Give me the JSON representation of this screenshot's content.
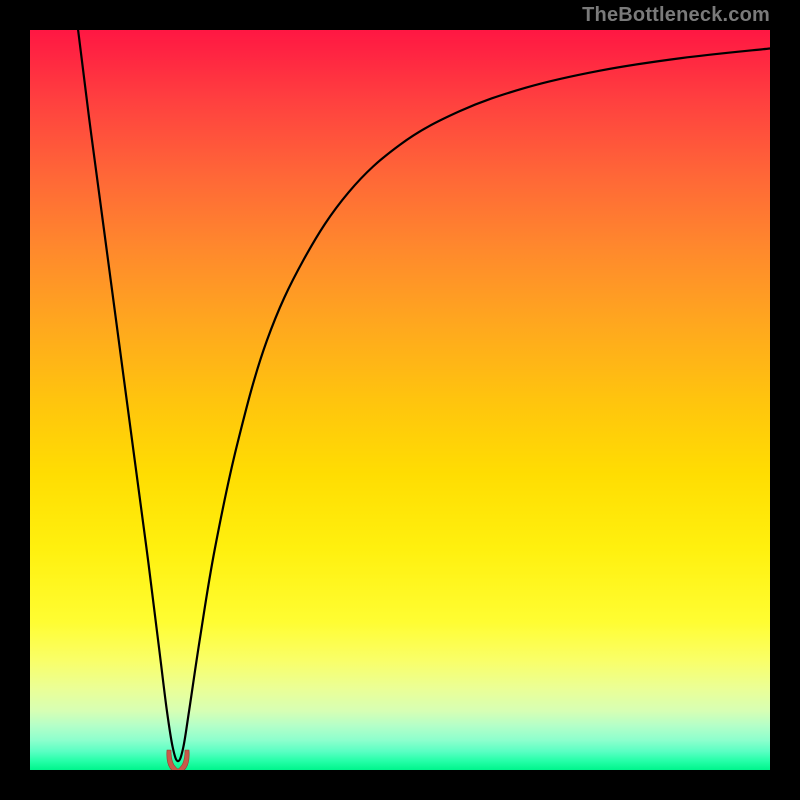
{
  "watermark": "TheBottleneck.com",
  "chart_data": {
    "type": "line",
    "title": "",
    "xlabel": "",
    "ylabel": "",
    "xlim": [
      0,
      100
    ],
    "ylim": [
      0,
      100
    ],
    "series": [
      {
        "name": "bottleneck-curve",
        "x": [
          6.5,
          8,
          10,
          12,
          14,
          16,
          17.5,
          18.5,
          19.3,
          20,
          20.7,
          21.5,
          23,
          25,
          28,
          32,
          37,
          43,
          50,
          58,
          67,
          77,
          88,
          100
        ],
        "y": [
          100,
          88,
          73,
          58,
          43,
          28,
          16,
          8,
          3,
          1.2,
          3,
          8,
          18,
          30,
          44,
          58,
          69,
          78,
          84.5,
          89,
          92.2,
          94.5,
          96.2,
          97.5
        ]
      }
    ],
    "marker": {
      "name": "optimal-point",
      "shape": "u-glyph",
      "color": "#c85a4a",
      "x": 20,
      "y": 1.2
    },
    "background": {
      "type": "vertical-gradient",
      "top_to_bottom_meaning": "high-bottleneck-to-low-bottleneck",
      "stops": [
        {
          "pct": 0,
          "hex": "#ff1743"
        },
        {
          "pct": 50,
          "hex": "#ffc40e"
        },
        {
          "pct": 80,
          "hex": "#fffd32"
        },
        {
          "pct": 100,
          "hex": "#00f58c"
        }
      ]
    }
  }
}
